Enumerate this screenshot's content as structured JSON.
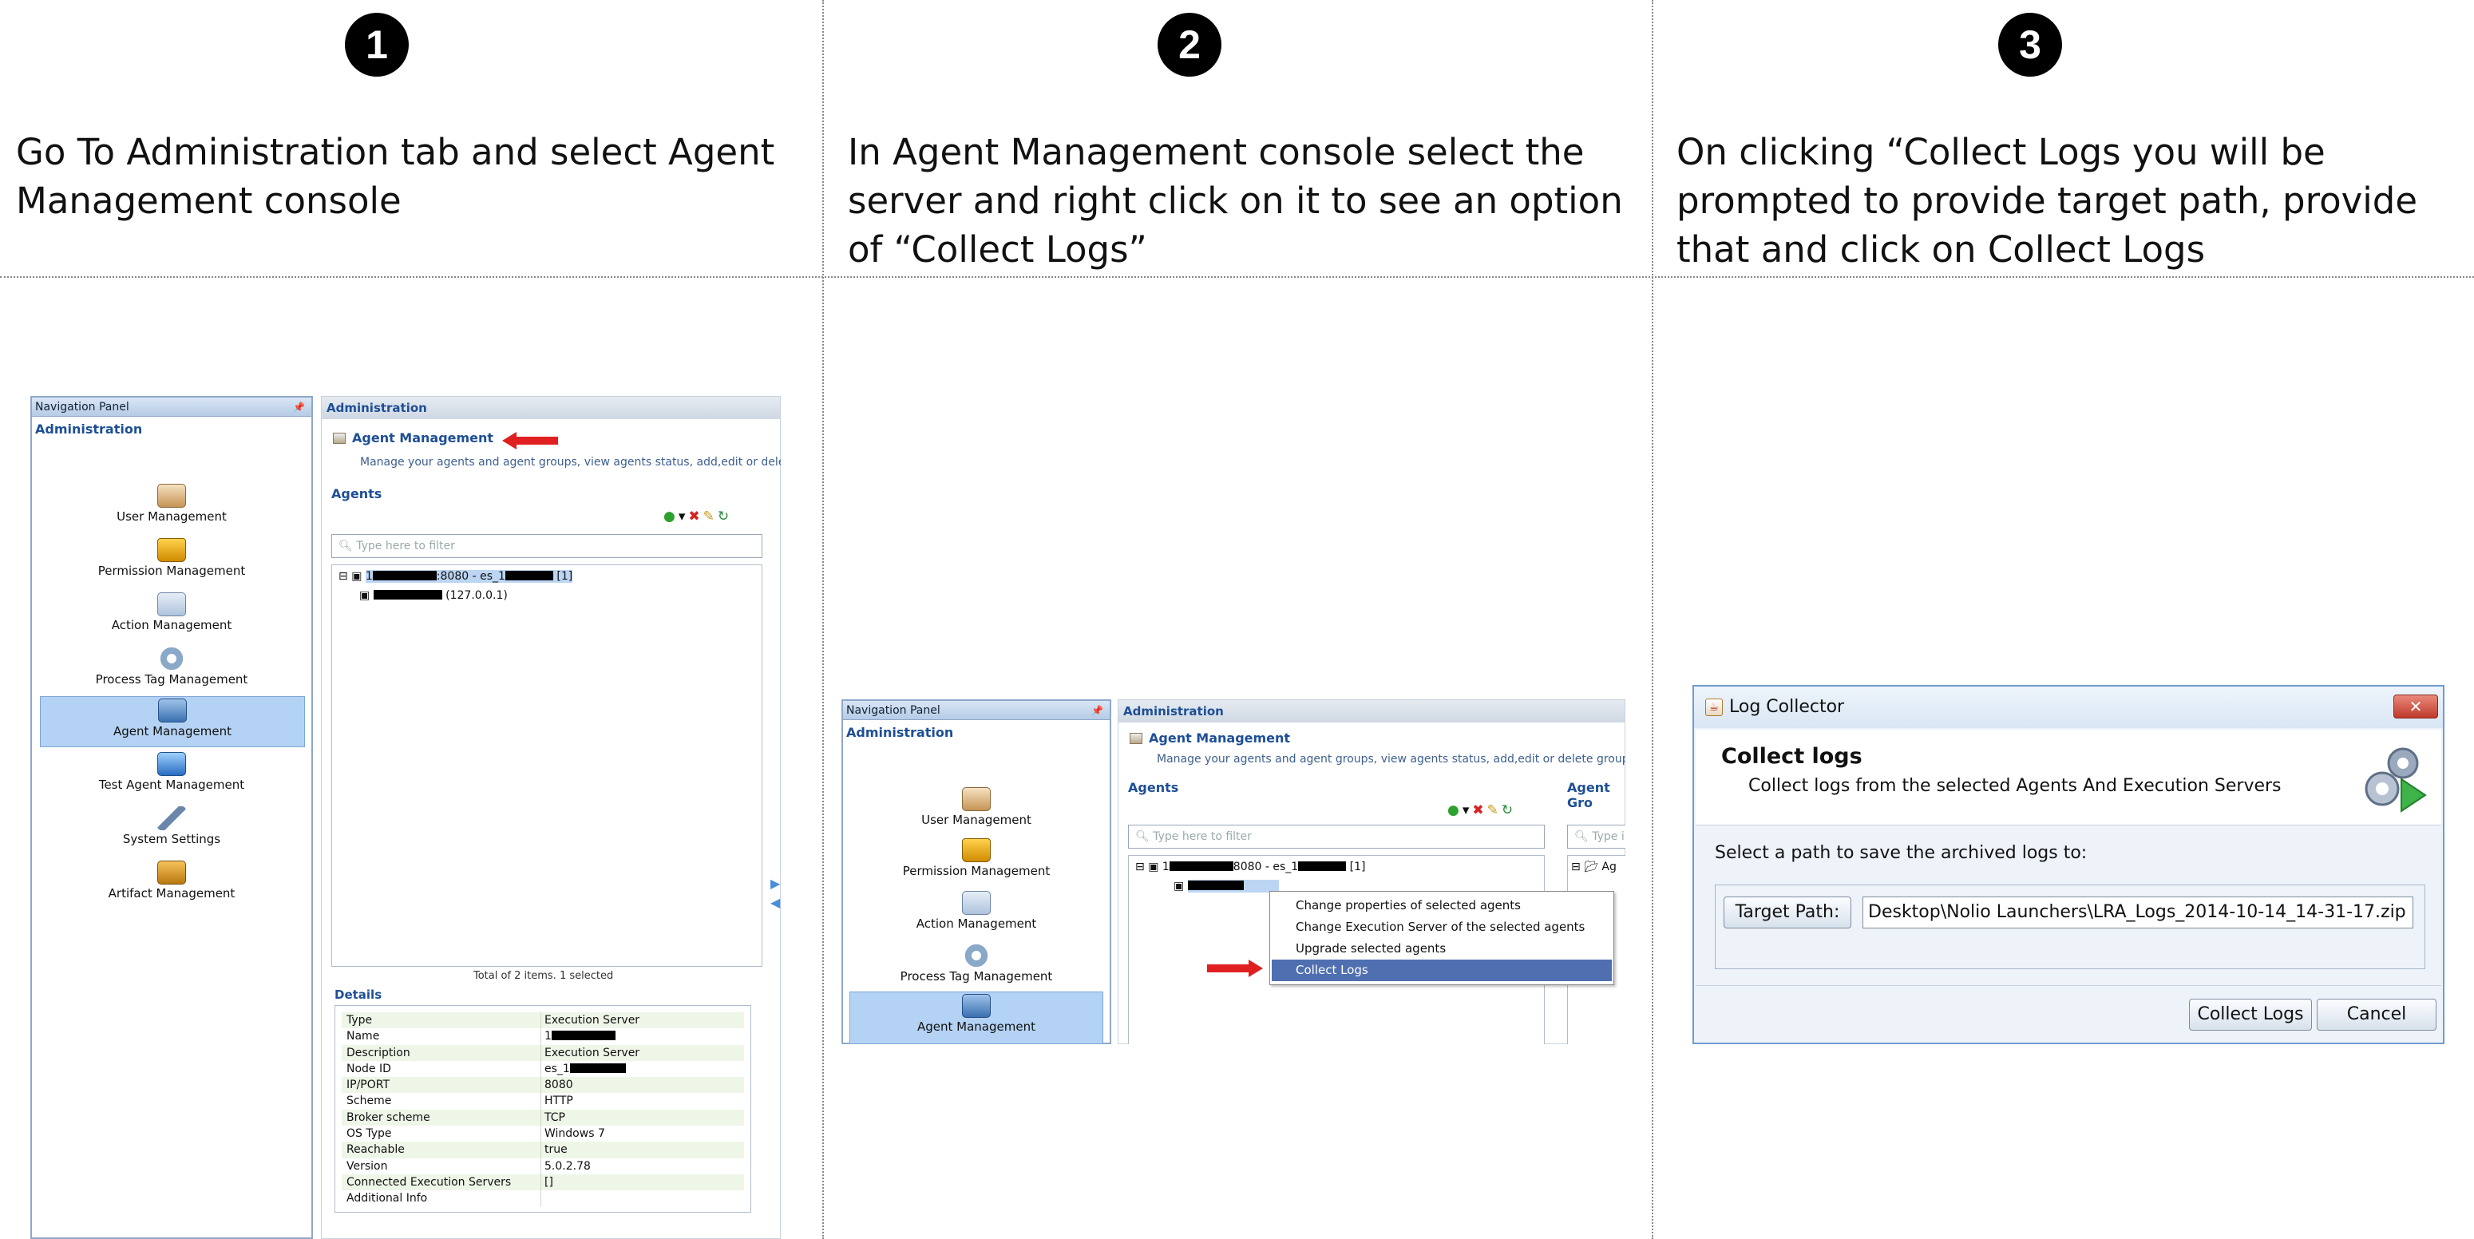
{
  "steps": [
    {
      "badge": "1",
      "text": "Go To Administration tab and select Agent Management console"
    },
    {
      "badge": "2",
      "text": "In Agent Management console select the server and right click on it to see an option of “Collect Logs”"
    },
    {
      "badge": "3",
      "text": "On clicking “Collect Logs you will be prompted to provide target path, provide that and click on Collect Logs"
    }
  ],
  "app": {
    "nav_panel_title": "Navigation Panel",
    "nav_section": "Administration",
    "nav_items": [
      "User Management",
      "Permission Management",
      "Action Management",
      "Process Tag Management",
      "Agent Management",
      "Test Agent Management",
      "System Settings",
      "Artifact Management"
    ],
    "admin_header": "Administration",
    "agent_mgmt_title": "Agent Management",
    "agent_mgmt_desc_1": "Manage your agents and agent groups, view agents status, add,edit or delete gr",
    "agent_mgmt_desc_2": "Manage your agents and agent groups, view agents status, add,edit or delete groups, and ma",
    "agents_label": "Agents",
    "agent_groups_label": "Agent Gro",
    "filter_placeholder": "Type here to filter",
    "filter_placeholder_short": "Type i",
    "tree_server_suffix": ":8080 - es_1",
    "tree_server_count": "[1]",
    "tree_server_label_2": "8080 - es_1",
    "tree_child": "(127.0.0.1)",
    "group_stub": "Ag",
    "total_text": "Total of 2 items. 1 selected",
    "details_label": "Details",
    "details": [
      {
        "k": "Type",
        "v": "Execution Server"
      },
      {
        "k": "Name",
        "v": "1"
      },
      {
        "k": "Description",
        "v": "Execution Server"
      },
      {
        "k": "Node ID",
        "v": "es_1"
      },
      {
        "k": "IP/PORT",
        "v": "8080"
      },
      {
        "k": "Scheme",
        "v": "HTTP"
      },
      {
        "k": "Broker scheme",
        "v": "TCP"
      },
      {
        "k": "OS Type",
        "v": "Windows 7"
      },
      {
        "k": "Reachable",
        "v": "true"
      },
      {
        "k": "Version",
        "v": "5.0.2.78"
      },
      {
        "k": "Connected Execution Servers",
        "v": "[]"
      },
      {
        "k": "Additional Info",
        "v": ""
      }
    ],
    "context_menu": [
      "Change properties of selected agents",
      "Change Execution Server of the selected agents",
      "Upgrade selected agents",
      "Collect Logs"
    ]
  },
  "dialog": {
    "title": "Log Collector",
    "heading": "Collect logs",
    "subheading": "Collect logs from the selected Agents And Execution Servers",
    "prompt": "Select a path to save the archived logs to:",
    "target_button": "Target Path:",
    "path_value": "Desktop\\Nolio Launchers\\LRA_Logs_2014-10-14_14-31-17.zip",
    "collect_button": "Collect Logs",
    "cancel_button": "Cancel"
  },
  "colors": {
    "accent": "#1e4f96",
    "menu_highlight": "#4f6fb0",
    "selection": "#b4d2f3",
    "arrow": "#e02020"
  }
}
